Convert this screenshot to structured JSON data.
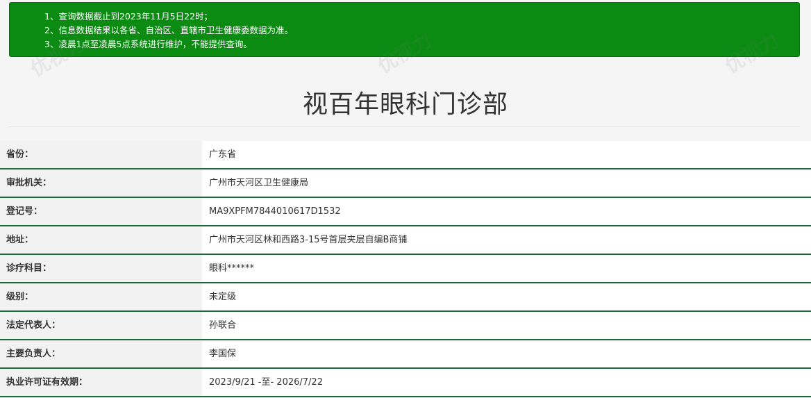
{
  "notice": {
    "lines": [
      "1、查询数据截止到2023年11月5日22时；",
      "2、信息数据结果以各省、自治区、直辖市卫生健康委数据为准。",
      "3、凌晨1点至凌晨5点系统进行维护，不能提供查询。"
    ]
  },
  "title": "视百年眼科门诊部",
  "rows": [
    {
      "label": "省份：",
      "value": "广东省"
    },
    {
      "label": "审批机关：",
      "value": "广州市天河区卫生健康局"
    },
    {
      "label": "登记号：",
      "value": "MA9XPFM7844010617D1532"
    },
    {
      "label": "地址：",
      "value": "广州市天河区林和西路3-15号首层夹层自编B商铺"
    },
    {
      "label": "诊疗科目：",
      "value": "眼科******"
    },
    {
      "label": "级别：",
      "value": "未定级"
    },
    {
      "label": "法定代表人：",
      "value": "孙联合"
    },
    {
      "label": "主要负责人：",
      "value": "李国保"
    },
    {
      "label": "执业许可证有效期：",
      "value": "2023/9/21 -至- 2026/7/22"
    }
  ],
  "watermark": "优视力"
}
